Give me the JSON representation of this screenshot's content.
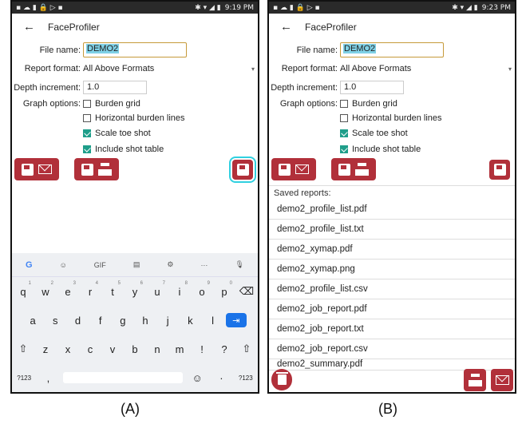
{
  "time_a": "9:19 PM",
  "time_b": "9:23 PM",
  "app_title": "FaceProfiler",
  "form": {
    "file_name_label": "File name:",
    "file_name_value": "DEMO2",
    "report_format_label": "Report format:",
    "report_format_value": "All Above Formats",
    "depth_label": "Depth increment:",
    "depth_value": "1.0",
    "graph_options_label": "Graph options:",
    "options": [
      {
        "label": "Burden grid",
        "checked": false
      },
      {
        "label": "Horizontal burden lines",
        "checked": false
      },
      {
        "label": "Scale toe shot",
        "checked": true
      },
      {
        "label": "Include shot table",
        "checked": true
      }
    ]
  },
  "keyboard": {
    "suggest": [
      "G",
      "☺",
      "GIF",
      "▤",
      "⚙",
      "···",
      "🎙"
    ],
    "row1": [
      [
        "q",
        "1"
      ],
      [
        "w",
        "2"
      ],
      [
        "e",
        "3"
      ],
      [
        "r",
        "4"
      ],
      [
        "t",
        "5"
      ],
      [
        "y",
        "6"
      ],
      [
        "u",
        "7"
      ],
      [
        "i",
        "8"
      ],
      [
        "o",
        "9"
      ],
      [
        "p",
        "0"
      ],
      [
        "⌫",
        ""
      ]
    ],
    "row2": [
      "a",
      "s",
      "d",
      "f",
      "g",
      "h",
      "j",
      "k",
      "l"
    ],
    "enter": "⇥",
    "row3": [
      "⇧",
      "z",
      "x",
      "c",
      "v",
      "b",
      "n",
      "m",
      "!",
      "?",
      "⇧"
    ],
    "sym": "?123",
    "comma": ",",
    "emoji": "☺",
    "period": "·",
    "sym2": "?123"
  },
  "saved_reports_label": "Saved reports:",
  "saved_reports": [
    "demo2_profile_list.pdf",
    "demo2_profile_list.txt",
    "demo2_xymap.pdf",
    "demo2_xymap.png",
    "demo2_profile_list.csv",
    "demo2_job_report.pdf",
    "demo2_job_report.txt",
    "demo2_job_report.csv",
    "demo2_summary.pdf"
  ],
  "caption_a": "(A)",
  "caption_b": "(B)",
  "accent_color": "#b1303a",
  "checkbox_color": "#1f9e8a"
}
